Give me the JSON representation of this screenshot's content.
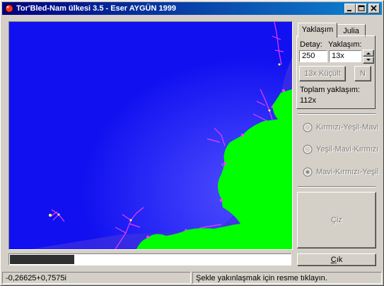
{
  "window": {
    "title": "Tor'Bled-Nam ülkesi 3.5 - Eser AYGÜN 1999"
  },
  "tabs": [
    {
      "label": "Yaklaşım",
      "active": true
    },
    {
      "label": "Julia",
      "active": false
    }
  ],
  "settings": {
    "detail_label": "Detay:",
    "zoom_label": "Yaklaşım:",
    "detail_value": "250",
    "zoom_value": "13x",
    "zoom_out_button": "13x Küçült",
    "n_button": "N",
    "total_zoom_label": "Toplam yaklaşım:",
    "total_zoom_value": "112x"
  },
  "color_schemes": [
    {
      "label": "Kırmızı-Yeşil-Mavi",
      "selected": false
    },
    {
      "label": "Yeşil-Mavi-Kırmızı",
      "selected": false
    },
    {
      "label": "Mavi-Kırmızı-Yeşil",
      "selected": true
    }
  ],
  "draw_button": "Çiz",
  "exit_button": "Çık",
  "exit_hotkey_letter": "Ç",
  "exit_rest": "ık",
  "progress": 0.23,
  "status": {
    "coordinate": "-0,26625+0,7575i",
    "hint": "Şekle yakınlaşmak için resme tıklayın."
  },
  "colors": {
    "set": "#00ff00",
    "background": "#2020ff",
    "fringe": "#ff40ff",
    "title_from": "#000080",
    "title_to": "#1084d0"
  }
}
